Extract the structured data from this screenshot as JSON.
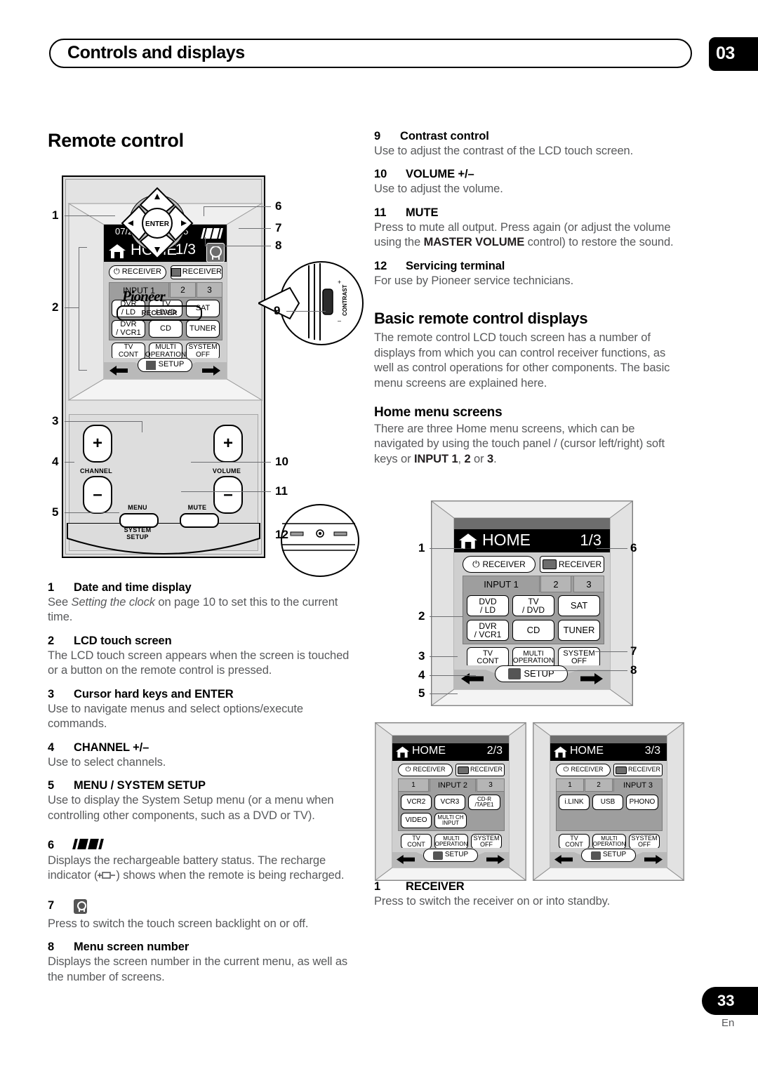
{
  "header": {
    "title": "Controls and displays",
    "chapter": "03"
  },
  "left_column": {
    "section_title": "Remote control",
    "items": [
      {
        "num": "1",
        "title": "Date and time display",
        "body_pre": "See ",
        "body_italic": "Setting the clock",
        "body_post": " on page 10 to set this to the current time."
      },
      {
        "num": "2",
        "title": "LCD touch screen",
        "body": "The LCD touch screen appears when the screen is touched or a button on the remote control is pressed."
      },
      {
        "num": "3",
        "title": "Cursor hard keys and ENTER",
        "body": "Use to navigate menus and select options/execute commands."
      },
      {
        "num": "4",
        "title": "CHANNEL  +/–",
        "body": "Use to select channels."
      },
      {
        "num": "5",
        "title": "MENU / SYSTEM SETUP",
        "body": "Use to display the System Setup menu (or a menu when controlling other components, such as a DVD or TV)."
      },
      {
        "num": "6",
        "title": "",
        "body_pre": "Displays the rechargeable battery status. The recharge indicator (",
        "body_post": ") shows when the remote is being recharged."
      },
      {
        "num": "7",
        "title": "",
        "body": "Press to switch the touch screen backlight on or off."
      },
      {
        "num": "8",
        "title": "Menu screen number",
        "body": "Displays the screen number in the current menu, as well as the number of screens."
      }
    ]
  },
  "right_column": {
    "items": [
      {
        "num": "9",
        "title": "Contrast control",
        "body": "Use to adjust the contrast of the LCD touch screen."
      },
      {
        "num": "10",
        "title": "VOLUME +/–",
        "body": "Use to adjust the volume."
      },
      {
        "num": "11",
        "title": "MUTE",
        "body_pre": "Press to mute all output. Press again (or adjust the volume using the ",
        "body_bold": "MASTER VOLUME",
        "body_post": " control) to restore the sound."
      },
      {
        "num": "12",
        "title": "Servicing terminal",
        "body": "For use by Pioneer service technicians."
      }
    ],
    "basic_displays": {
      "heading": "Basic remote control displays",
      "body": "The remote control LCD touch screen has a number of displays from which you can control receiver functions, as well as control operations for other components. The basic menu screens are explained here."
    },
    "home_menu": {
      "heading": "Home menu screens",
      "body_pre": "There are three Home menu screens, which can be navigated by using the touch panel    /    (cursor left/right) soft keys or ",
      "body_bold1": "INPUT 1",
      "mid1": ", ",
      "body_bold2": "2",
      "mid2": " or ",
      "body_bold3": "3",
      "body_post": "."
    },
    "receiver_item": {
      "num": "1",
      "title": "RECEIVER",
      "body": "Press to switch the receiver on or into standby."
    }
  },
  "remote_illustration": {
    "lcd": {
      "date": "07/24",
      "time": "PM 3:55",
      "home_label": "HOME",
      "page": "1/3",
      "receiver_power": "RECEIVER",
      "receiver_source": "RECEIVER",
      "input_tab_active": "INPUT 1",
      "input_tabs": [
        "2",
        "3"
      ],
      "source_keys": [
        "DVR\n/ LD",
        "TV\n/ DVD",
        "SAT",
        "DVR\n/ VCR1",
        "CD",
        "TUNER"
      ],
      "bottom_keys": [
        "TV\nCONT",
        "MULTI\nOPERATION",
        "SYSTEM\nOFF"
      ],
      "setup_key": "SETUP"
    },
    "hard_keys": {
      "channel": "CHANNEL",
      "volume": "VOLUME",
      "enter": "ENTER",
      "menu": "MENU",
      "system_setup": "SYSTEM\nSETUP",
      "mute": "MUTE",
      "brand": "Pioneer",
      "receiver_pill": "RECEIVER",
      "plus": "+",
      "minus": "–"
    },
    "contrast_detail": {
      "label": "CONTRAST",
      "plus": "+",
      "minus": "–"
    },
    "callouts": [
      "1",
      "2",
      "3",
      "4",
      "5",
      "6",
      "7",
      "8",
      "9",
      "10",
      "11",
      "12"
    ]
  },
  "home_screens": [
    {
      "id": "screen-1-3",
      "home_label": "HOME",
      "page": "1/3",
      "receiver_power": "RECEIVER",
      "receiver_source": "RECEIVER",
      "tabs": [
        "INPUT 1",
        "2",
        "3"
      ],
      "active_tab_index": 0,
      "source_keys": [
        "DVD\n/ LD",
        "TV\n/ DVD",
        "SAT",
        "DVR\n/ VCR1",
        "CD",
        "TUNER"
      ],
      "bottom_keys": [
        "TV\nCONT",
        "MULTI\nOPERATION",
        "SYSTEM\nOFF"
      ],
      "setup_key": "SETUP",
      "callouts_left": [
        "1",
        "2",
        "3",
        "4",
        "5"
      ],
      "callouts_right": [
        "6",
        "7",
        "8"
      ]
    },
    {
      "id": "screen-2-3",
      "home_label": "HOME",
      "page": "2/3",
      "receiver_power": "RECEIVER",
      "receiver_source": "RECEIVER",
      "tabs": [
        "1",
        "INPUT 2",
        "3"
      ],
      "active_tab_index": 1,
      "source_keys": [
        "VCR2",
        "VCR3",
        "CD-R\n/TAPE1",
        "VIDEO",
        "MULTI CH\nINPUT"
      ],
      "bottom_keys": [
        "TV\nCONT",
        "MULTI\nOPERATION",
        "SYSTEM\nOFF"
      ],
      "setup_key": "SETUP"
    },
    {
      "id": "screen-3-3",
      "home_label": "HOME",
      "page": "3/3",
      "receiver_power": "RECEIVER",
      "receiver_source": "RECEIVER",
      "tabs": [
        "1",
        "2",
        "INPUT 3"
      ],
      "active_tab_index": 2,
      "source_keys": [
        "i.LINK",
        "USB",
        "PHONO"
      ],
      "bottom_keys": [
        "TV\nCONT",
        "MULTI\nOPERATION",
        "SYSTEM\nOFF"
      ],
      "setup_key": "SETUP"
    }
  ],
  "footer": {
    "page_number": "33",
    "language": "En"
  }
}
